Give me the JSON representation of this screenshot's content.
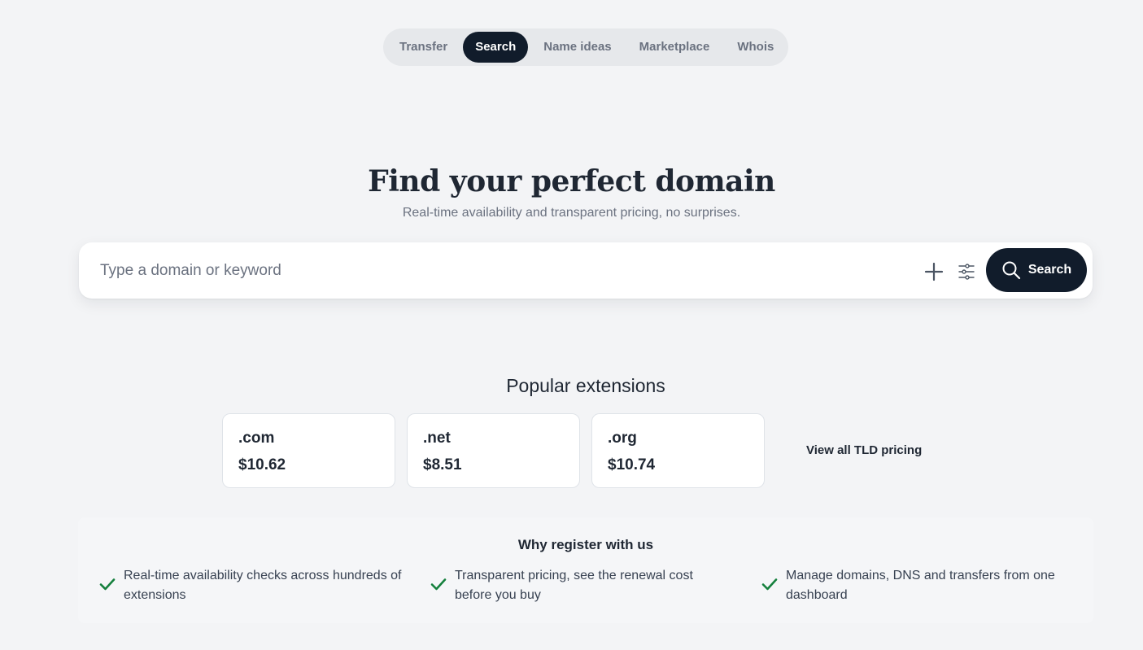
{
  "tabs": [
    {
      "label": "Transfer",
      "active": false
    },
    {
      "label": "Search",
      "active": true
    },
    {
      "label": "Name ideas",
      "active": false
    },
    {
      "label": "Marketplace",
      "active": false
    },
    {
      "label": "Whois",
      "active": false
    }
  ],
  "hero": {
    "title": "Find your perfect domain",
    "subtitle": "Real-time availability and transparent pricing, no surprises."
  },
  "search": {
    "placeholder": "Type a domain or keyword",
    "value": "",
    "button_label": "Search",
    "icons": [
      "plus-icon",
      "filter-sliders-icon",
      "search-icon"
    ]
  },
  "popular": {
    "title": "Popular extensions",
    "extensions": [
      {
        "name": ".com",
        "price": "$10.62"
      },
      {
        "name": ".net",
        "price": "$8.51"
      },
      {
        "name": ".org",
        "price": "$10.74"
      }
    ],
    "view_all_label": "View all TLD pricing"
  },
  "why": {
    "title": "Why register with us",
    "benefits": [
      {
        "text": "Real-time availability checks across hundreds of extensions"
      },
      {
        "text": "Transparent pricing, see the renewal cost before you buy"
      },
      {
        "text": "Manage domains, DNS and transfers from one dashboard"
      }
    ]
  },
  "colors": {
    "background": "#f3f4f6",
    "primary_dark": "#111c2b",
    "check_green": "#15803d",
    "muted_text": "#6b7280"
  }
}
